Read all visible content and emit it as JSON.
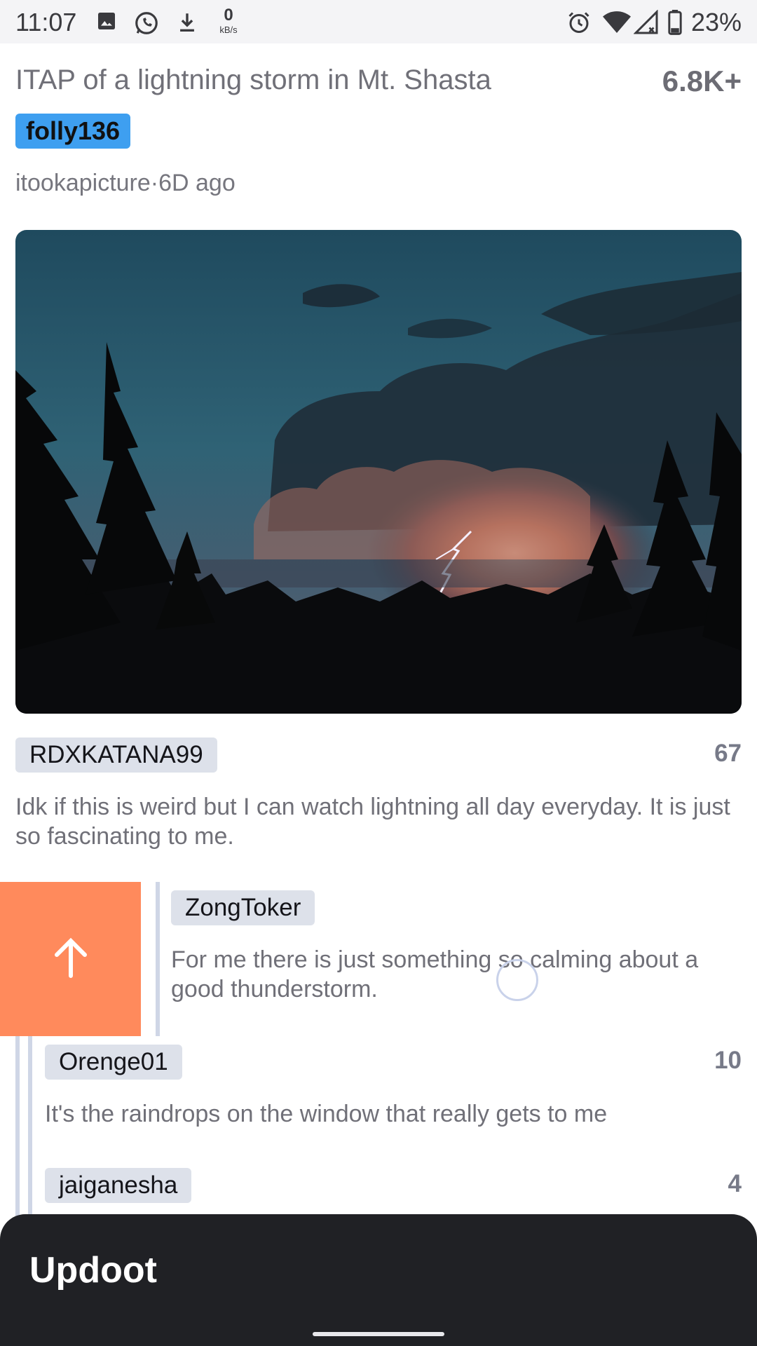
{
  "status_bar": {
    "time": "11:07",
    "net_speed_value": "0",
    "net_speed_unit": "kB/s",
    "battery_percent": "23%",
    "icons": [
      "image-icon",
      "whatsapp-icon",
      "download-icon",
      "alarm-icon",
      "wifi-icon",
      "signal-icon",
      "battery-icon"
    ]
  },
  "post": {
    "title": "ITAP of a lightning storm in Mt. Shasta",
    "score": "6.8K+",
    "author": "folly136",
    "subreddit": "itookapicture",
    "separator": "·",
    "age": "6D ago",
    "image_alt": "lightning-storm-photo"
  },
  "comments": [
    {
      "author": "RDXKATANA99",
      "score": "67",
      "body": "Idk if this is weird but I can watch lightning all day everyday. It is just so fascinating to me."
    },
    {
      "author": "ZongToker",
      "score": "",
      "body": "For me there is just something so calming about a good thunderstorm."
    },
    {
      "author": "Orenge01",
      "score": "10",
      "body": "It's the raindrops on the window that really gets to me"
    },
    {
      "author": "jaiganesha",
      "score": "4",
      "body": ""
    }
  ],
  "swipe_action": {
    "icon": "upvote-arrow-icon",
    "color": "#ff8a5c"
  },
  "snackbar": {
    "text": "Updoot"
  },
  "colors": {
    "author_chip": "#3e9ff0",
    "user_chip": "#dde1ea",
    "rail": "#cfd6e6",
    "snackbar": "#202125"
  }
}
